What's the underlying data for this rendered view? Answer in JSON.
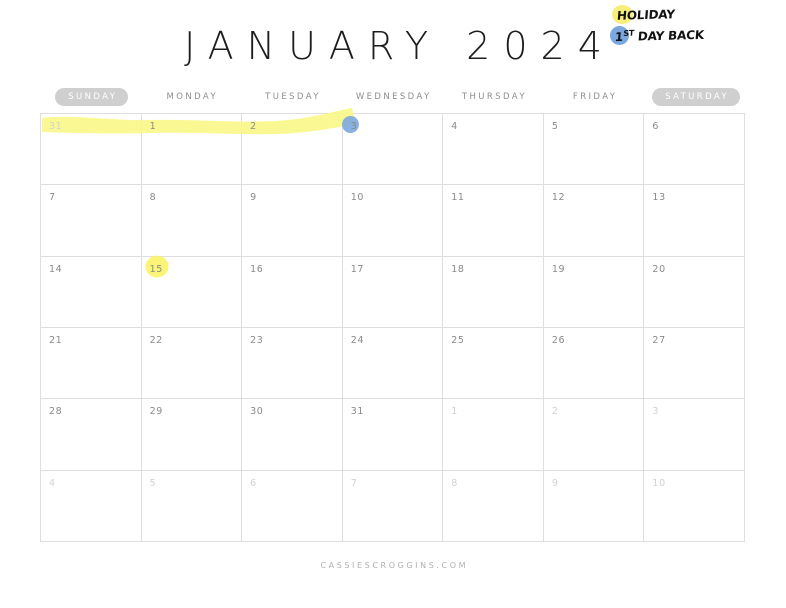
{
  "title": "JANUARY 2024",
  "footer": "CASSIESCROGGINS.COM",
  "colors": {
    "highlighter_yellow": "#faf78a",
    "marker_blue": "#7ba7e0",
    "grid_line": "#dedede",
    "day_number": "#8a8a8a",
    "day_number_outside": "#d2d2d2",
    "weekday_label": "#8e8e8e",
    "weekend_pill": "#cfcfcf",
    "title_text": "#1d1d1d",
    "footer_text": "#b0b0b0"
  },
  "legend": {
    "items": [
      {
        "label": "HOLIDAY",
        "prefix": "",
        "dot_color": "#f7ef7a",
        "dot_name": "yellow"
      },
      {
        "label": "DAY BACK",
        "prefix": "1",
        "prefix_sup": "ST",
        "dot_color": "#7ba7e0",
        "dot_name": "blue"
      }
    ]
  },
  "weekdays": [
    {
      "label": "SUNDAY",
      "pill": true
    },
    {
      "label": "MONDAY",
      "pill": false
    },
    {
      "label": "TUESDAY",
      "pill": false
    },
    {
      "label": "WEDNESDAY",
      "pill": false
    },
    {
      "label": "THURSDAY",
      "pill": false
    },
    {
      "label": "FRIDAY",
      "pill": false
    },
    {
      "label": "SATURDAY",
      "pill": true
    }
  ],
  "weeks": [
    [
      {
        "day": "31",
        "outside": true
      },
      {
        "day": "1",
        "outside": false
      },
      {
        "day": "2",
        "outside": false
      },
      {
        "day": "3",
        "outside": false
      },
      {
        "day": "4",
        "outside": false
      },
      {
        "day": "5",
        "outside": false
      },
      {
        "day": "6",
        "outside": false
      }
    ],
    [
      {
        "day": "7",
        "outside": false
      },
      {
        "day": "8",
        "outside": false
      },
      {
        "day": "9",
        "outside": false
      },
      {
        "day": "10",
        "outside": false
      },
      {
        "day": "11",
        "outside": false
      },
      {
        "day": "12",
        "outside": false
      },
      {
        "day": "13",
        "outside": false
      }
    ],
    [
      {
        "day": "14",
        "outside": false
      },
      {
        "day": "15",
        "outside": false
      },
      {
        "day": "16",
        "outside": false
      },
      {
        "day": "17",
        "outside": false
      },
      {
        "day": "18",
        "outside": false
      },
      {
        "day": "19",
        "outside": false
      },
      {
        "day": "20",
        "outside": false
      }
    ],
    [
      {
        "day": "21",
        "outside": false
      },
      {
        "day": "22",
        "outside": false
      },
      {
        "day": "23",
        "outside": false
      },
      {
        "day": "24",
        "outside": false
      },
      {
        "day": "25",
        "outside": false
      },
      {
        "day": "26",
        "outside": false
      },
      {
        "day": "27",
        "outside": false
      }
    ],
    [
      {
        "day": "28",
        "outside": false
      },
      {
        "day": "29",
        "outside": false
      },
      {
        "day": "30",
        "outside": false
      },
      {
        "day": "31",
        "outside": false
      },
      {
        "day": "1",
        "outside": true
      },
      {
        "day": "2",
        "outside": true
      },
      {
        "day": "3",
        "outside": true
      }
    ],
    [
      {
        "day": "4",
        "outside": true
      },
      {
        "day": "5",
        "outside": true
      },
      {
        "day": "6",
        "outside": true
      },
      {
        "day": "7",
        "outside": true
      },
      {
        "day": "8",
        "outside": true
      },
      {
        "day": "9",
        "outside": true
      },
      {
        "day": "10",
        "outside": true
      }
    ]
  ],
  "annotations": [
    {
      "name": "highlighter-stroke-dec31-jan2",
      "type": "highlighter-stroke",
      "covers": [
        "31",
        "1",
        "2"
      ],
      "color": "#faf78a"
    },
    {
      "name": "blue-circle-jan3",
      "type": "circle",
      "covers": [
        "3"
      ],
      "color": "#7ba7e0"
    },
    {
      "name": "yellow-circle-jan15",
      "type": "circle",
      "covers": [
        "15"
      ],
      "color": "#f9f35e"
    }
  ]
}
